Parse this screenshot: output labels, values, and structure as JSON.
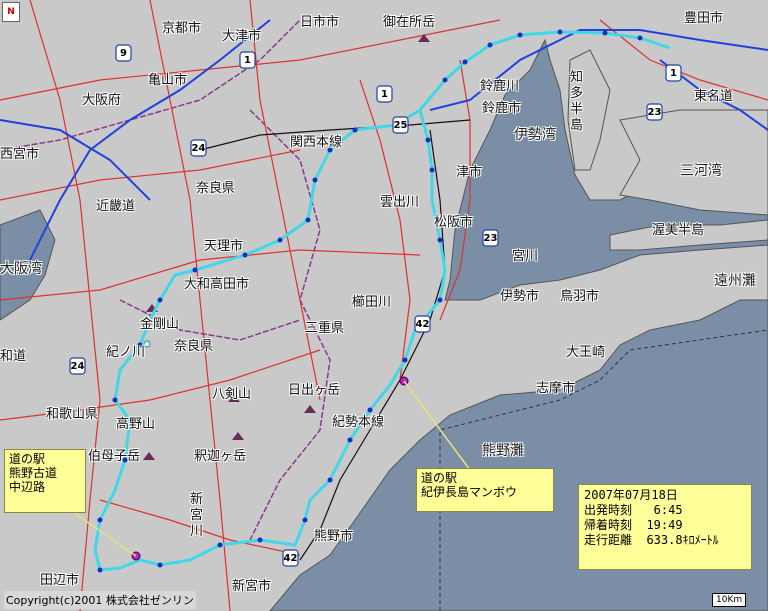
{
  "compass": {
    "label": "N"
  },
  "labels": {
    "kyoto": "京都市",
    "otsu": "大津市",
    "yokkaichi_city": "日市市",
    "mt_gozaisho": "御在所岳",
    "toyota": "豊田市",
    "osaka_fu": "大阪府",
    "nishinomiya": "西宮市",
    "nara": "奈良県",
    "kameyama": "亀山市",
    "suzuka_river": "鈴鹿川",
    "suzuka_city": "鈴鹿市",
    "chita": "知多半島",
    "kansai_line": "関西本線",
    "ise_bay": "伊勢湾",
    "tokaido": "東名道",
    "mikawa_bay": "三河湾",
    "kumozu_river": "雲出川",
    "tsu": "津市",
    "matsusaka": "松阪市",
    "atsumi": "渥美半島",
    "tenri": "天理市",
    "miyagawa": "宮川",
    "enshu_nada": "遠州灘",
    "yamato_takada": "大和高田市",
    "kushida_river": "櫛田川",
    "ise_city": "伊勢市",
    "toba": "鳥羽市",
    "osaka_bay": "大阪湾",
    "kongo": "金剛山",
    "mie": "三重県",
    "nara_ken": "奈良県",
    "daiozaki": "大王崎",
    "kinokawa": "紀ノ川",
    "shima": "志摩市",
    "wakayama": "和歌山県",
    "hatsushi": "八剣山",
    "hidegatake": "日出ヶ岳",
    "koyasan": "高野山",
    "kisei": "紀勢本線",
    "kumano_nada": "熊野灘",
    "gomadan": "伯母子岳",
    "shakagatake": "釈迦ヶ岳",
    "shingu_river": "新宮川",
    "kumano": "熊野市",
    "tanabe": "田辺市",
    "shingu": "新宮市",
    "kawachi": "和道",
    "kinki": "近畿道"
  },
  "routes": [
    "9",
    "1",
    "1",
    "24",
    "25",
    "23",
    "23",
    "24",
    "42",
    "42",
    "1"
  ],
  "callouts": {
    "left": "道の駅\n熊野古道\n中辺路",
    "right": "道の駅\n紀伊長島マンボウ"
  },
  "stats": {
    "date": "2007年07月18日",
    "depart": "出発時刻   6:45",
    "arrive": "帰着時刻  19:49",
    "distance": "走行距離  633.8ｷﾛﾒｰﾄﾙ"
  },
  "copyright": "Copyright(c)2001 株式会社ゼンリン",
  "scale": "10Km",
  "colors": {
    "land": "#c9c9c9",
    "sea": "#7a8fa6",
    "route": "#40d8e8",
    "roads_red": "#e03030",
    "roads_blue": "#2040e0",
    "callout": "#ffff99"
  }
}
